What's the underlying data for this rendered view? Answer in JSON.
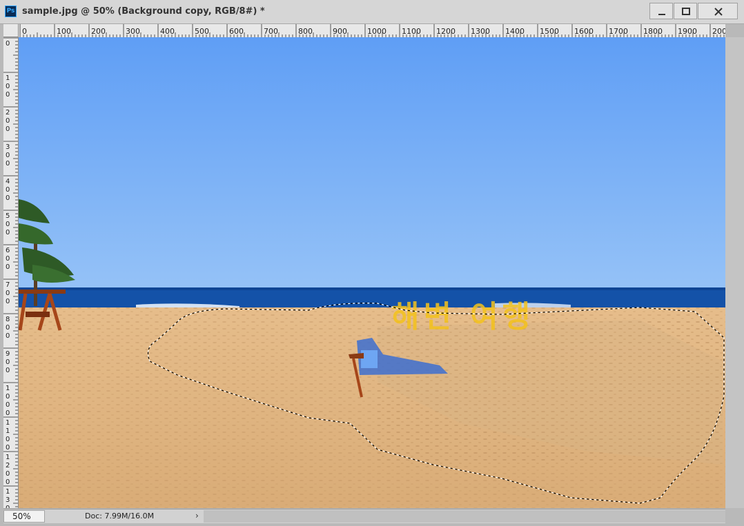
{
  "window": {
    "app_icon": "Ps",
    "title": "sample.jpg @ 50% (Background copy, RGB/8#) *",
    "buttons": [
      "minimize-icon",
      "maximize-icon",
      "close-icon"
    ]
  },
  "ruler": {
    "h_labels": [
      "0",
      "100",
      "200",
      "300",
      "400",
      "500",
      "600",
      "700",
      "800",
      "900",
      "1000",
      "1100",
      "1200",
      "1300",
      "1400",
      "1500",
      "1600",
      "1700",
      "1800",
      "1900",
      "200"
    ],
    "v_labels": [
      "0",
      "1\n0\n0",
      "2\n0\n0",
      "3\n0\n0",
      "4\n0\n0",
      "5\n0\n0",
      "6\n0\n0",
      "7\n0\n0",
      "8\n0\n0",
      "9\n0\n0",
      "1\n0\n0\n0",
      "1\n1\n0\n0",
      "1\n2\n0\n0",
      "1\n3\n0"
    ]
  },
  "canvas": {
    "description_text": "",
    "overlay_text": "해변 여행",
    "colors": {
      "sky_top": "#5f9ef5",
      "sky_bottom": "#8fbdf7",
      "sea": "#1452a8",
      "sand": "#e3b887",
      "text_yellow": "#f4c21c"
    }
  },
  "status": {
    "zoom": "50%",
    "doc": "Doc: 7.99M/16.0M",
    "arrow": "›"
  }
}
